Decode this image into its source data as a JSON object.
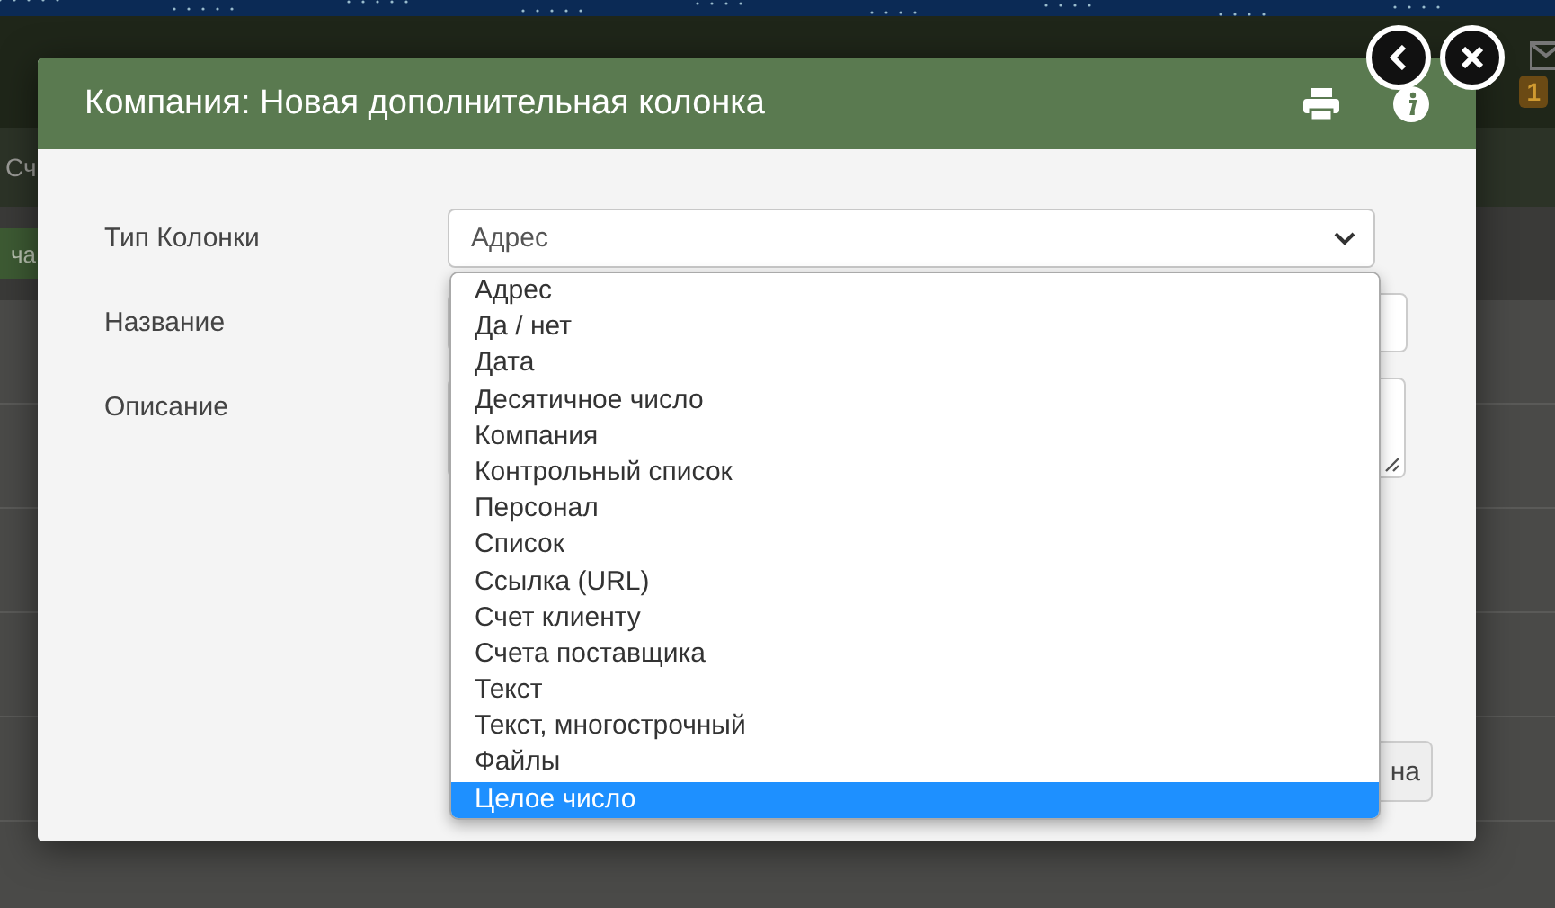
{
  "background": {
    "section_label": "Сч",
    "button_label": "ча",
    "badge": "1"
  },
  "dialog": {
    "title": "Компания: Новая дополнительная колонка",
    "fields": [
      {
        "label": "Тип Колонки",
        "kind": "select",
        "value": "Адрес"
      },
      {
        "label": "Название",
        "kind": "input"
      },
      {
        "label": "Описание",
        "kind": "textarea"
      }
    ],
    "dropdown": [
      {
        "label": "Адрес",
        "selected": false
      },
      {
        "label": "Да / нет",
        "selected": false
      },
      {
        "label": "Дата",
        "selected": false
      },
      {
        "label": "Десятичное число",
        "selected": false
      },
      {
        "label": "Компания",
        "selected": false
      },
      {
        "label": "Контрольный список",
        "selected": false
      },
      {
        "label": "Персонал",
        "selected": false
      },
      {
        "label": "Список",
        "selected": false
      },
      {
        "label": "Ссылка (URL)",
        "selected": false
      },
      {
        "label": "Счет клиенту",
        "selected": false
      },
      {
        "label": "Счета поставщика",
        "selected": false
      },
      {
        "label": "Текст",
        "selected": false
      },
      {
        "label": "Текст, многострочный",
        "selected": false
      },
      {
        "label": "Файлы",
        "selected": false
      },
      {
        "label": "Целое число",
        "selected": true
      }
    ],
    "footer_button": "на"
  }
}
